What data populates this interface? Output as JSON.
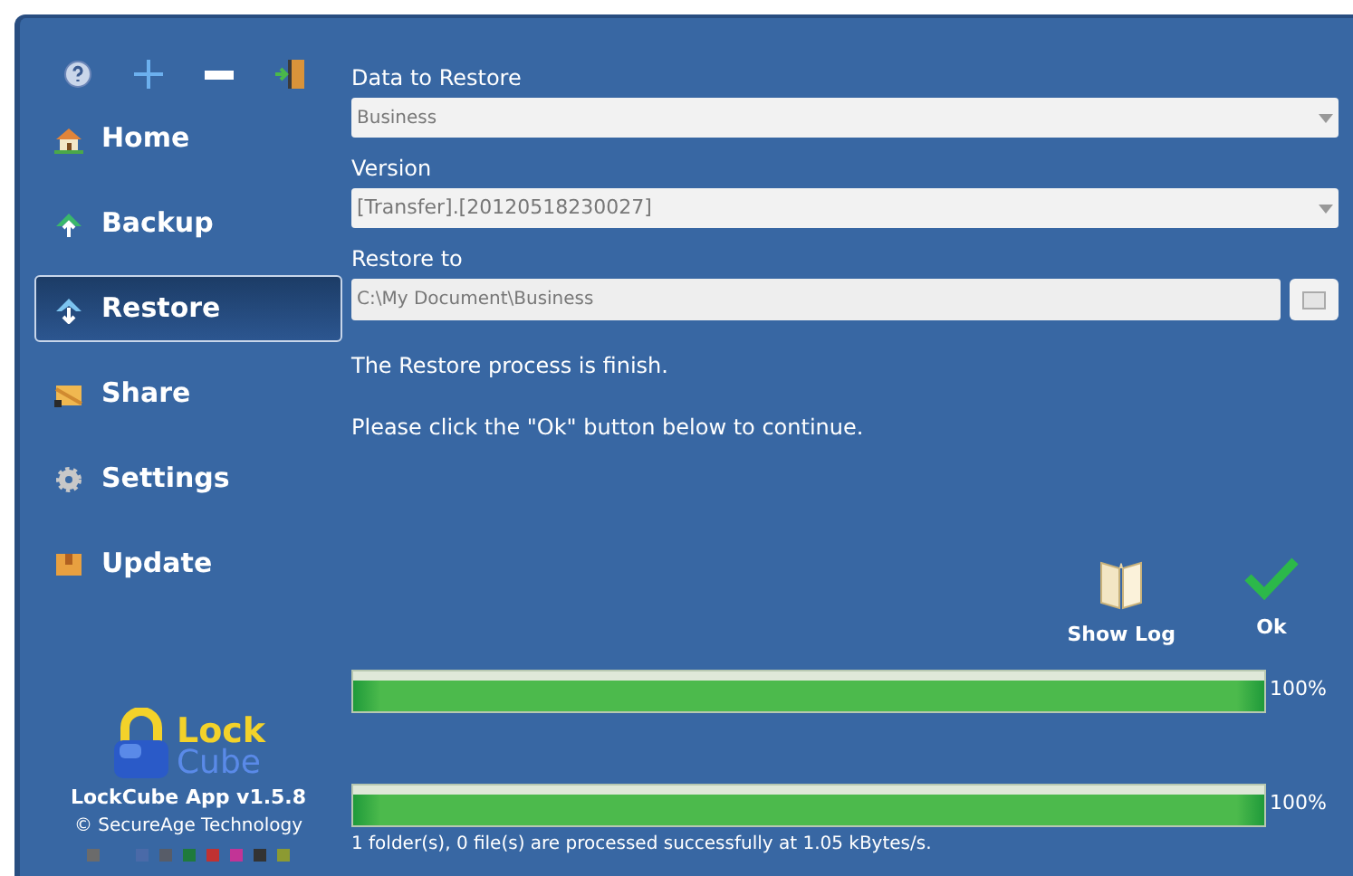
{
  "toolbar": [
    {
      "kind": "help"
    },
    {
      "kind": "add"
    },
    {
      "kind": "remove"
    },
    {
      "kind": "exit"
    }
  ],
  "nav": [
    {
      "label": "Home",
      "kind": "home",
      "selected": false
    },
    {
      "label": "Backup",
      "kind": "backup",
      "selected": false
    },
    {
      "label": "Restore",
      "kind": "restore",
      "selected": true
    },
    {
      "label": "Share",
      "kind": "share",
      "selected": false
    },
    {
      "label": "Settings",
      "kind": "settings",
      "selected": false
    },
    {
      "label": "Update",
      "kind": "update",
      "selected": false
    }
  ],
  "logo": {
    "word1": "Lock",
    "word2": "Cube"
  },
  "app_name": "LockCube App v1.5.8",
  "copyright": "© SecureAge Technology",
  "swatches": [
    {
      "color": "#6b6b6b"
    },
    {
      "color": "#4a6aa8"
    },
    {
      "color": "#575c68"
    },
    {
      "color": "#1f7a3c"
    },
    {
      "color": "#c03232"
    },
    {
      "color": "#c23496"
    },
    {
      "color": "#333333"
    },
    {
      "color": "#8c9a32"
    }
  ],
  "form": {
    "data_label": "Data to Restore",
    "data_value": "Business",
    "version_label": "Version",
    "version_value": "[Transfer].[20120518230027]",
    "restore_label": "Restore to",
    "restore_value": "C:\\My Document\\Business"
  },
  "messages": [
    "The Restore process is finish.",
    "Please click the \"Ok\" button below to continue."
  ],
  "actions": [
    {
      "label": "Show Log",
      "kind": "log"
    },
    {
      "label": "Ok",
      "kind": "ok"
    }
  ],
  "progress": [
    {
      "level": 1,
      "reading": "100%"
    },
    {
      "level": 1,
      "reading": "100%"
    }
  ],
  "status": "1 folder(s), 0 file(s) are processed successfully at 1.05 kBytes/s."
}
